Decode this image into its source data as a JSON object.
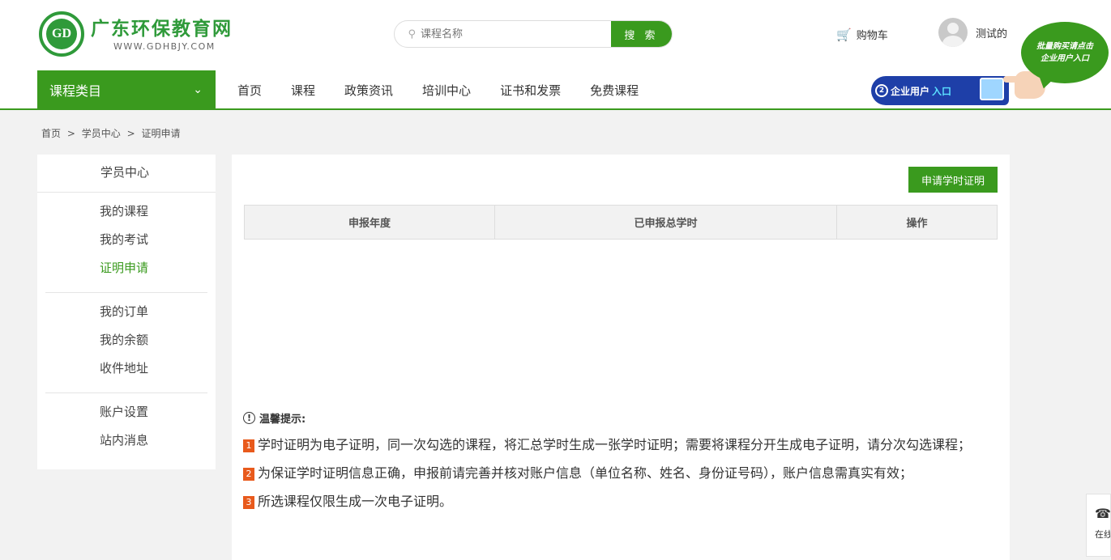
{
  "header": {
    "logo_title": "广东环保教育网",
    "logo_url_text": "WWW.GDHBJY.COM",
    "logo_mark_text": "GD",
    "search_placeholder": "课程名称",
    "search_button": "搜 索",
    "cart_label": "购物车",
    "user_name": "测试的",
    "bubble_line1": "批量购买请点击",
    "bubble_line2": "企业用户入口",
    "enterprise_entry_prefix": "企业用户",
    "enterprise_entry_highlight": "入口",
    "enterprise_entry_num": "2"
  },
  "nav": {
    "category_label": "课程类目",
    "items": [
      "首页",
      "课程",
      "政策资讯",
      "培训中心",
      "证书和发票",
      "免费课程"
    ]
  },
  "breadcrumb": {
    "items": [
      "首页",
      "学员中心",
      "证明申请"
    ],
    "separator": ">"
  },
  "sidebar": {
    "title": "学员中心",
    "groups": [
      [
        "我的课程",
        "我的考试",
        "证明申请"
      ],
      [
        "我的订单",
        "我的余额",
        "收件地址"
      ],
      [
        "账户设置",
        "站内消息"
      ]
    ],
    "active": "证明申请"
  },
  "main": {
    "apply_button": "申请学时证明",
    "table_headers": [
      "申报年度",
      "已申报总学时",
      "操作"
    ],
    "tips_title": "温馨提示:",
    "tips": [
      {
        "num": "1",
        "text": "学时证明为电子证明，同一次勾选的课程，将汇总学时生成一张学时证明；需要将课程分开生成电子证明，请分次勾选课程；"
      },
      {
        "num": "2",
        "text": "为保证学时证明信息正确，申报前请完善并核对账户信息（单位名称、姓名、身份证号码），账户信息需真实有效；"
      },
      {
        "num": "3",
        "text": "所选课程仅限生成一次电子证明。"
      }
    ]
  },
  "float_tab": {
    "label": "在线"
  },
  "colors": {
    "brand_green": "#3a9a1e",
    "tip_orange": "#e85a1c"
  }
}
